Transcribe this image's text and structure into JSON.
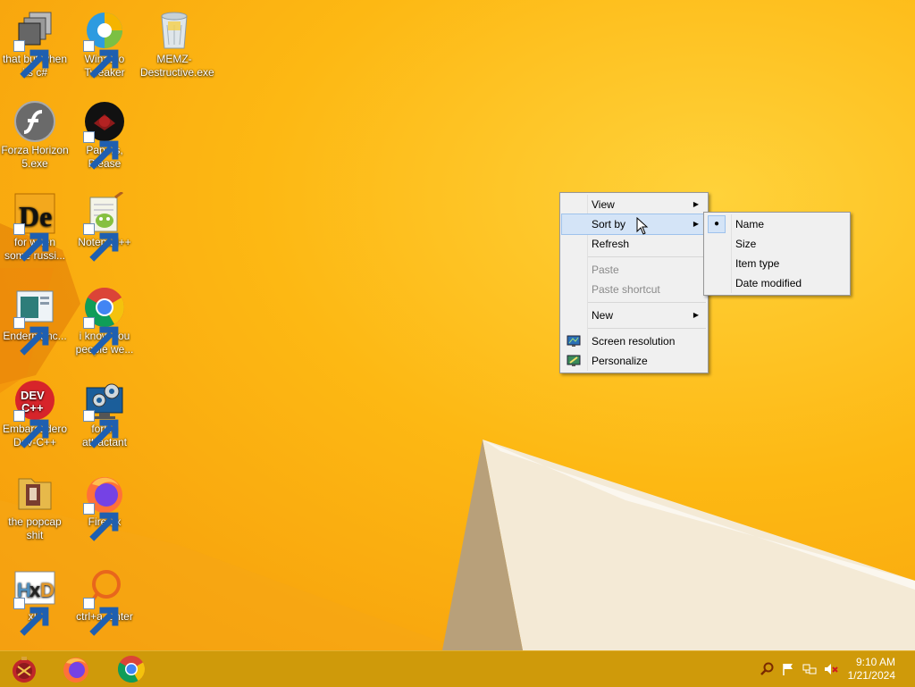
{
  "desktop": {
    "icons": [
      {
        "label": "that but when its c#"
      },
      {
        "label": "Winaero Tweaker"
      },
      {
        "label": "MEMZ-Destructive.exe"
      },
      {
        "label": "Forza Horizon 5.exe"
      },
      {
        "label": "Papers, Please"
      },
      {
        "label": "for when some russi..."
      },
      {
        "label": "Notepad++"
      },
      {
        "label": "Endermanc..."
      },
      {
        "label": "i know you people we..."
      },
      {
        "label": "Embarcadero Dev-C++"
      },
      {
        "label": "forkie attractant"
      },
      {
        "label": "the popcap shit"
      },
      {
        "label": "Firefox"
      },
      {
        "label": "xD"
      },
      {
        "label": "ctrl+a, enter"
      }
    ]
  },
  "context_menu": {
    "items": [
      {
        "label": "View",
        "submenu": true
      },
      {
        "label": "Sort by",
        "submenu": true,
        "highlighted": true
      },
      {
        "label": "Refresh"
      },
      {
        "label": "Paste",
        "disabled": true
      },
      {
        "label": "Paste shortcut",
        "disabled": true
      },
      {
        "label": "New",
        "submenu": true
      },
      {
        "label": "Screen resolution",
        "icon": "monitor-icon"
      },
      {
        "label": "Personalize",
        "icon": "personalize-icon"
      }
    ]
  },
  "sort_submenu": {
    "items": [
      {
        "label": "Name",
        "selected": true
      },
      {
        "label": "Size"
      },
      {
        "label": "Item type"
      },
      {
        "label": "Date modified"
      }
    ]
  },
  "taskbar": {
    "pinned": [
      "start-orb-icon",
      "firefox-icon",
      "chrome-icon"
    ],
    "tray": [
      "search-icon",
      "action-center-flag-icon",
      "network-icon",
      "volume-muted-icon"
    ],
    "clock": {
      "time": "9:10 AM",
      "date": "1/21/2024"
    }
  },
  "colors": {
    "wallpaper": "#fdb813",
    "taskbar": "#cf9a0a",
    "menu_bg": "#f0f0f0",
    "menu_highlight": "#d4e4f7"
  }
}
